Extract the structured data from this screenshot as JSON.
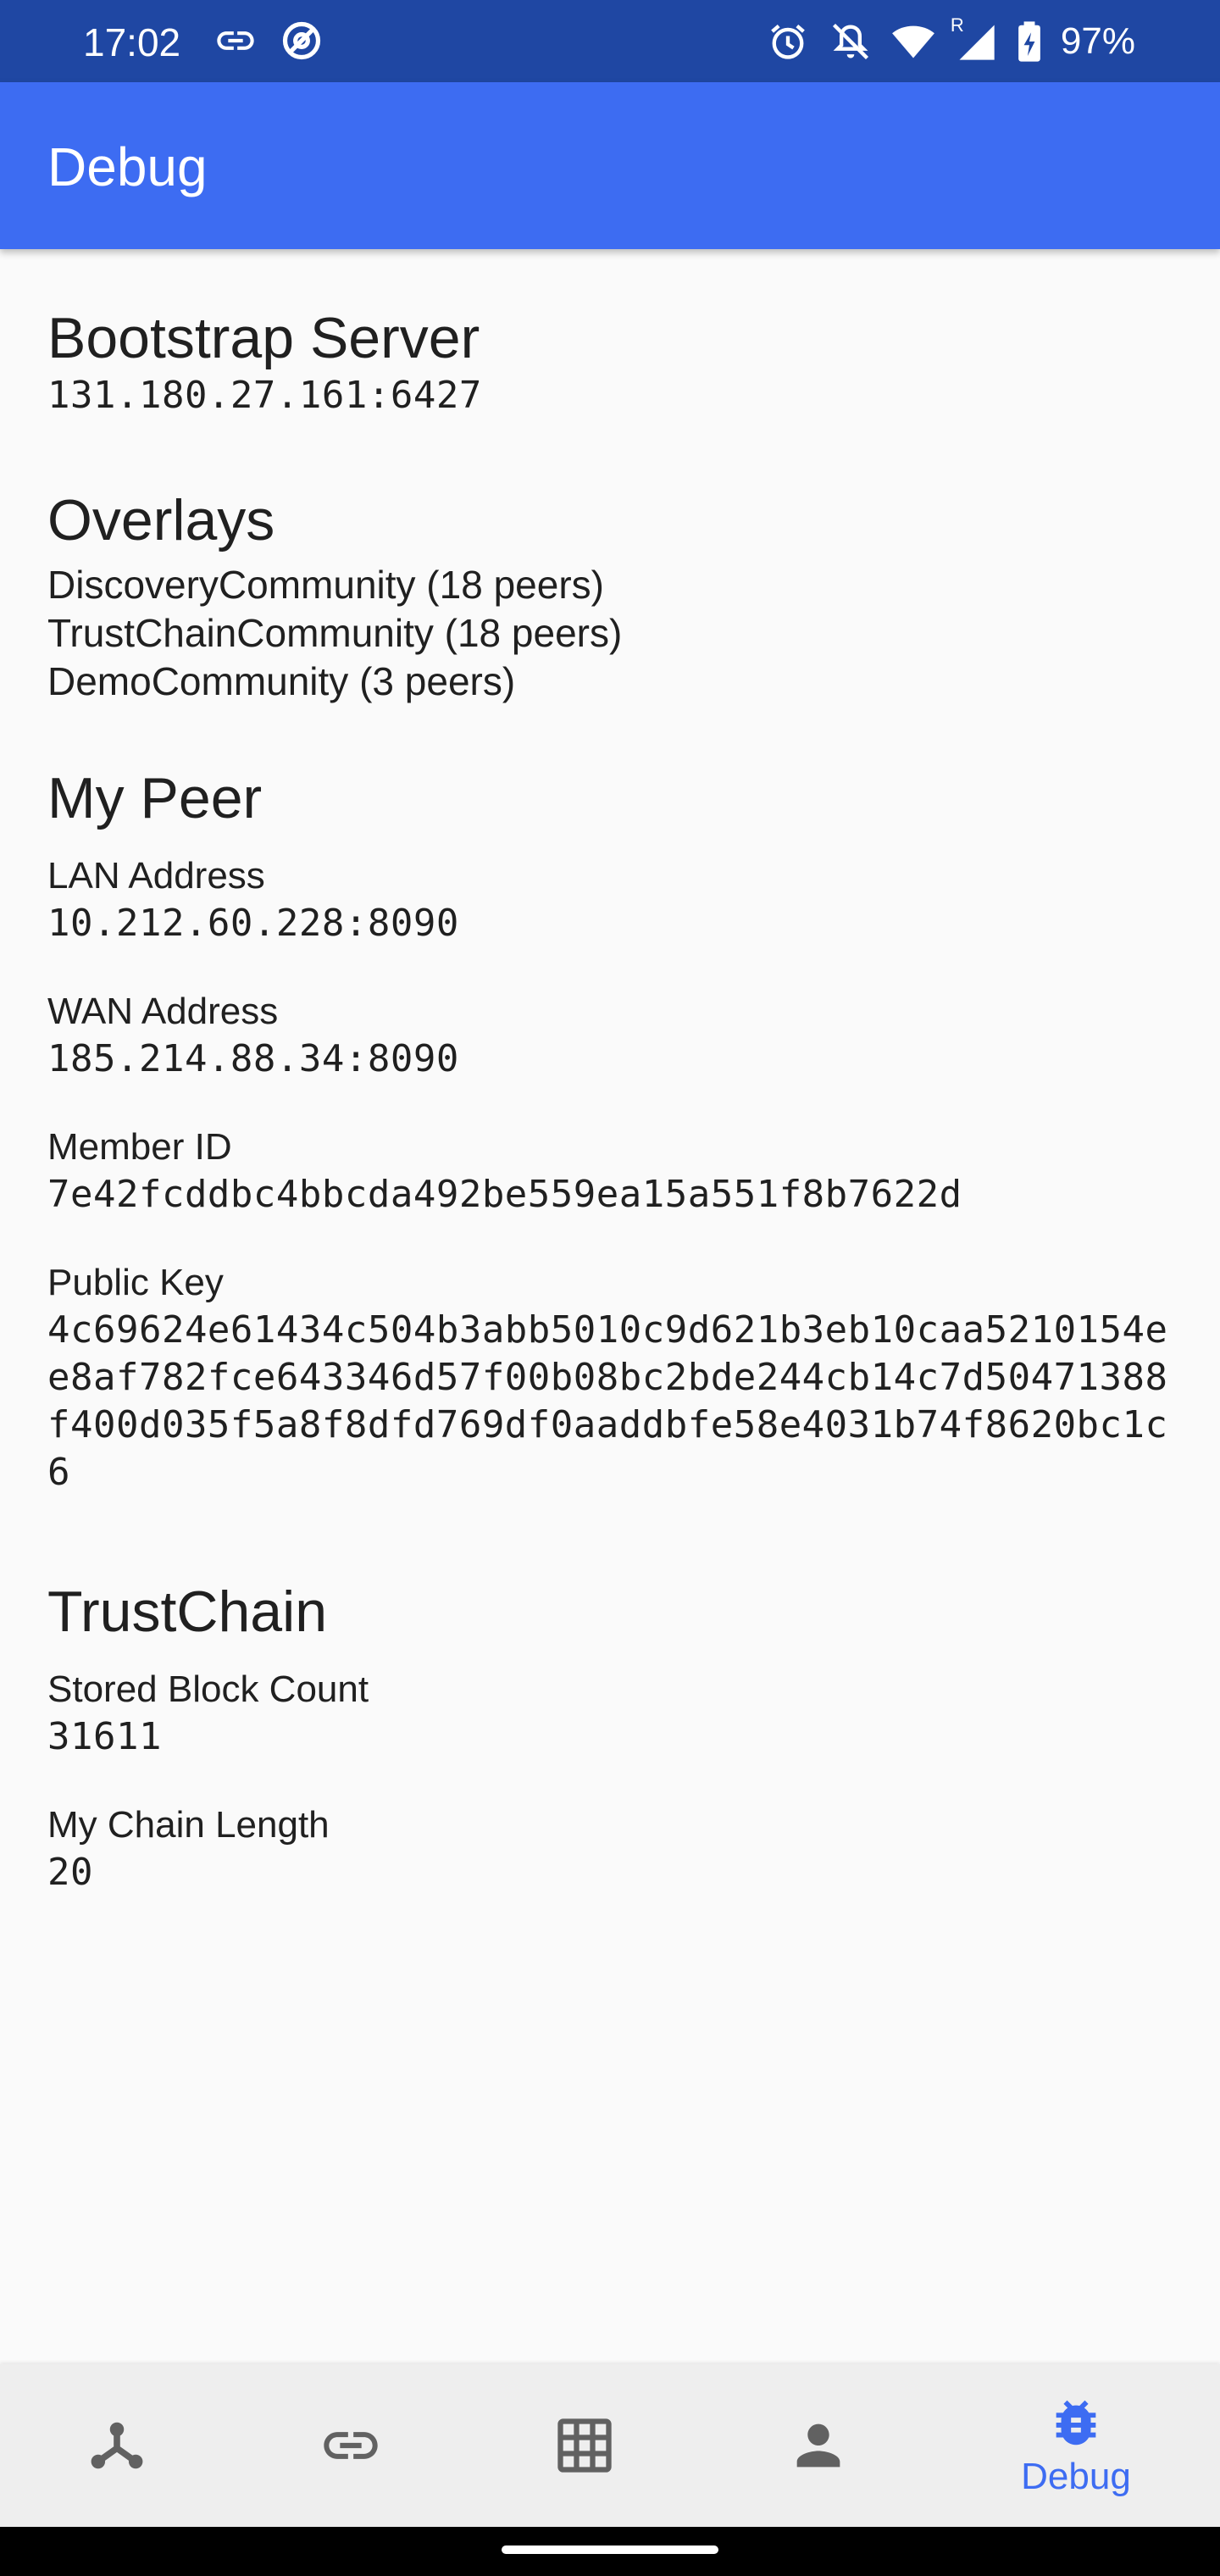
{
  "status_bar": {
    "time": "17:02",
    "battery": "97%",
    "left_icons": [
      "link-icon",
      "at-sign-icon"
    ],
    "right_icons": [
      "alarm-icon",
      "notifications-off-icon",
      "wifi-icon",
      "cell-signal-icon",
      "battery-charging-icon"
    ],
    "roaming_indicator": "R",
    "background": "#1f47a3"
  },
  "app_bar": {
    "title": "Debug",
    "background": "#3d6cf2"
  },
  "bootstrap": {
    "heading": "Bootstrap Server",
    "address": "131.180.27.161:6427"
  },
  "overlays": {
    "heading": "Overlays",
    "items": [
      "DiscoveryCommunity (18 peers)",
      "TrustChainCommunity (18 peers)",
      "DemoCommunity (3 peers)"
    ]
  },
  "my_peer": {
    "heading": "My Peer",
    "lan_label": "LAN Address",
    "lan_value": "10.212.60.228:8090",
    "wan_label": "WAN Address",
    "wan_value": "185.214.88.34:8090",
    "member_label": "Member ID",
    "member_value": "7e42fcddbc4bbcda492be559ea15a551f8b7622d",
    "pubkey_label": "Public Key",
    "pubkey_value": "4c69624e61434c504b3abb5010c9d621b3eb10caa5210154ee8af782fce643346d57f00b08bc2bde244cb14c7d50471388f400d035f5a8f8dfd769df0aaddbfe58e4031b74f8620bc1c6"
  },
  "trustchain": {
    "heading": "TrustChain",
    "stored_label": "Stored Block Count",
    "stored_value": "31611",
    "chain_label": "My Chain Length",
    "chain_value": "20"
  },
  "bottom_nav": {
    "items": [
      {
        "icon": "peers-network-icon",
        "label": ""
      },
      {
        "icon": "link-icon",
        "label": ""
      },
      {
        "icon": "grid-icon",
        "label": ""
      },
      {
        "icon": "person-icon",
        "label": ""
      },
      {
        "icon": "bug-icon",
        "label": "Debug",
        "active": true
      }
    ],
    "active_color": "#3d6cf2",
    "inactive_color": "#616161"
  }
}
